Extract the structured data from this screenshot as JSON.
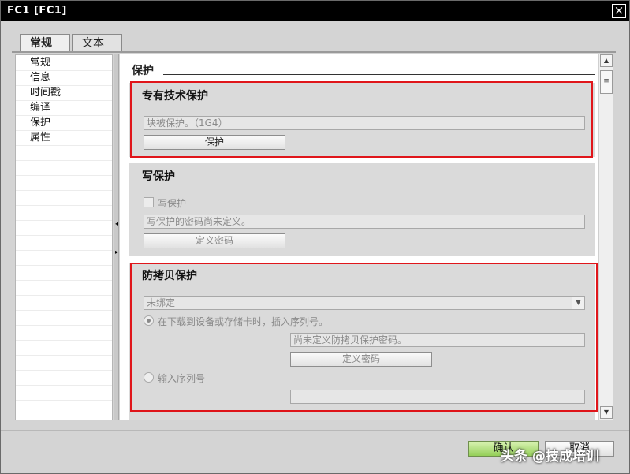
{
  "window": {
    "title": "FC1 [FC1]",
    "close_glyph": "×"
  },
  "tabs": [
    {
      "label": "常规",
      "active": true
    },
    {
      "label": "文本",
      "active": false
    }
  ],
  "nav": {
    "items": [
      {
        "label": "常规"
      },
      {
        "label": "信息"
      },
      {
        "label": "时间戳"
      },
      {
        "label": "编译"
      },
      {
        "label": "保护"
      },
      {
        "label": "属性"
      }
    ]
  },
  "content": {
    "section_title": "保护",
    "know_how": {
      "title": "专有技术保护",
      "status_value": "块被保护。（1G4）",
      "button_label": "保护"
    },
    "write_protect": {
      "title": "写保护",
      "checkbox_label": "写保护",
      "status_value": "写保护的密码尚未定义。",
      "button_label": "定义密码"
    },
    "copy_protect": {
      "title": "防拷贝保护",
      "dropdown_value": "未绑定",
      "radio1_label": "在下载到设备或存储卡时，插入序列号。",
      "password_status": "尚未定义防拷贝保护密码。",
      "button_label": "定义密码",
      "radio2_label": "输入序列号",
      "serial_value": ""
    }
  },
  "footer": {
    "ok_label": "确认",
    "cancel_label": "取消",
    "watermark": "头条 @技成培训"
  },
  "colors": {
    "highlight_border": "#e0161b",
    "ok_button": "#94cf58",
    "titlebar": "#000000"
  },
  "icons": {
    "close": "close-icon",
    "scroll_up": "chevron-up-icon",
    "scroll_down": "chevron-down-icon",
    "dropdown": "chevron-down-icon"
  }
}
